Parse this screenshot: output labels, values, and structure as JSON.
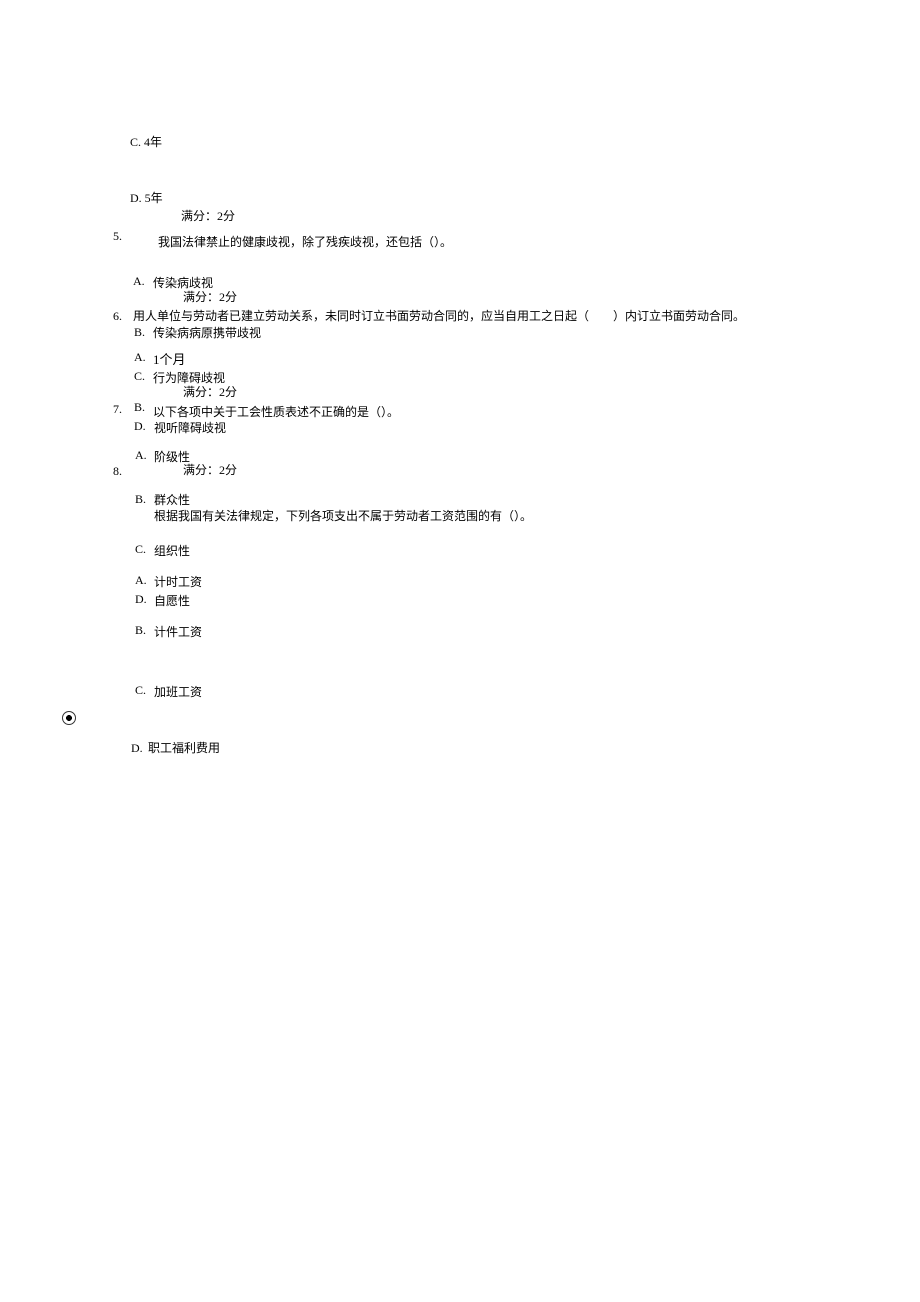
{
  "labels": {
    "score": "满分：2分"
  },
  "prevOptions": {
    "c": {
      "letter": "C.",
      "text": "4年"
    },
    "d": {
      "letter": "D.",
      "text": "5年"
    }
  },
  "q5": {
    "num": "5.",
    "stem": "我国法律禁止的健康歧视，除了残疾歧视，还包括（）。",
    "a": {
      "letter": "A.",
      "text": "传染病歧视"
    },
    "b": {
      "letter": "B.",
      "text": "传染病病原携带歧视"
    },
    "c": {
      "letter": "C.",
      "text": "行为障碍歧视"
    },
    "d": {
      "letter": "D.",
      "text": "视听障碍歧视"
    }
  },
  "q6": {
    "num": "6.",
    "stem": "用人单位与劳动者已建立劳动关系，未同时订立书面劳动合同的，应当自用工之日起（　　）内订立书面劳动合同。",
    "a": {
      "letter": "A.",
      "text": "1个月"
    },
    "b": {
      "letter": "B.",
      "text": ""
    }
  },
  "q7": {
    "num": "7.",
    "stem": "以下各项中关于工会性质表述不正确的是（）。",
    "a": {
      "letter": "A.",
      "text": "阶级性"
    },
    "b": {
      "letter": "B.",
      "text": "群众性"
    },
    "c": {
      "letter": "C.",
      "text": "组织性"
    },
    "d": {
      "letter": "D.",
      "text": "自愿性"
    }
  },
  "q8": {
    "num": "8.",
    "stem": "根据我国有关法律规定，下列各项支出不属于劳动者工资范围的有（）。",
    "a": {
      "letter": "A.",
      "text": "计时工资"
    },
    "b": {
      "letter": "B.",
      "text": "计件工资"
    },
    "c": {
      "letter": "C.",
      "text": "加班工资"
    },
    "d": {
      "letter": "D.",
      "text": "职工福利费用"
    }
  }
}
